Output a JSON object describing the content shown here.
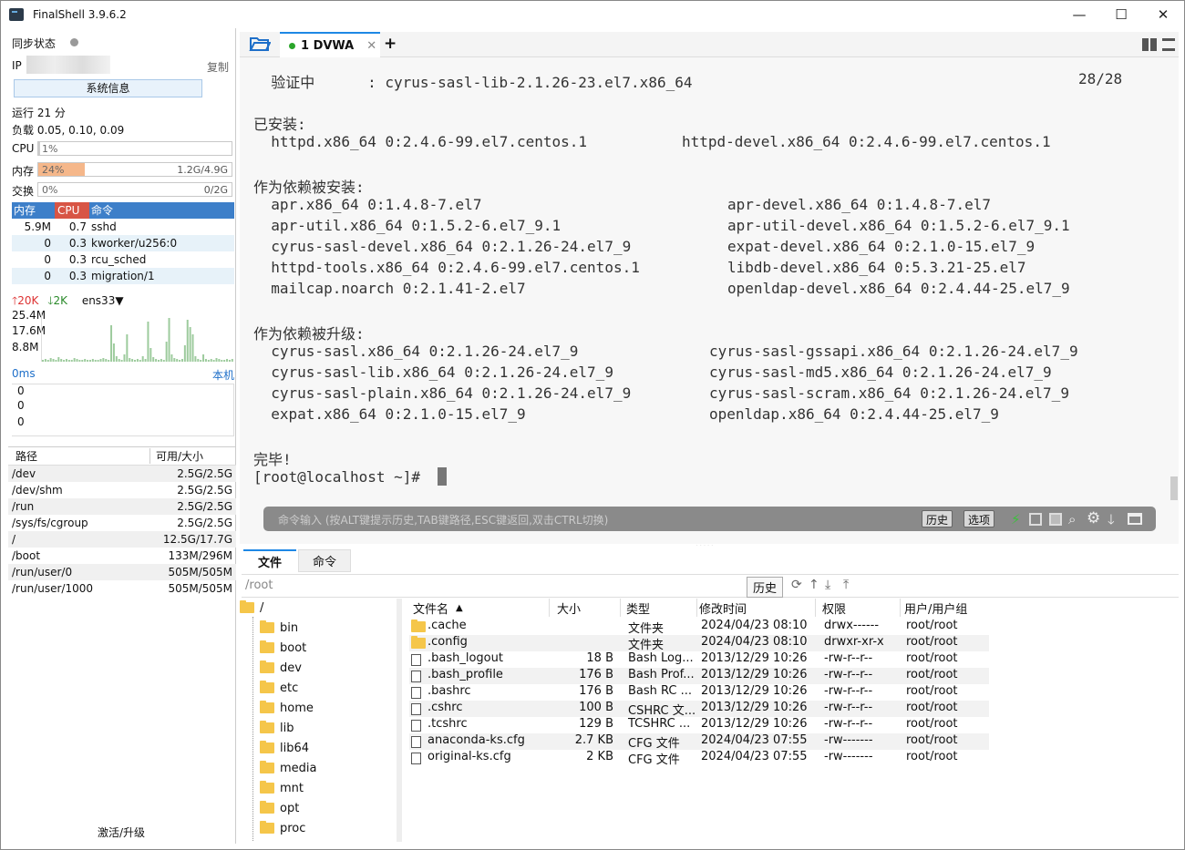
{
  "app": {
    "title": "FinalShell 3.9.6.2"
  },
  "window": {
    "minimize": "—",
    "maximize": "☐",
    "close": "✕"
  },
  "sidebar": {
    "sync_label": "同步状态",
    "ip_label": "IP",
    "copy_label": "复制",
    "sysinfo_button": "系统信息",
    "uptime": "运行 21 分",
    "load": "负载 0.05, 0.10, 0.09",
    "cpu": {
      "label": "CPU",
      "value": "1%",
      "fraction": 0.01
    },
    "mem": {
      "label": "内存",
      "value": "24%",
      "detail": "1.2G/4.9G",
      "fraction": 0.24
    },
    "swap": {
      "label": "交换",
      "value": "0%",
      "detail": "0/2G",
      "fraction": 0.0
    },
    "proc_headers": {
      "mem": "内存",
      "cpu": "CPU",
      "cmd": "命令"
    },
    "processes": [
      {
        "mem": "5.9M",
        "cpu": "0.7",
        "cmd": "sshd"
      },
      {
        "mem": "0",
        "cpu": "0.3",
        "cmd": "kworker/u256:0"
      },
      {
        "mem": "0",
        "cpu": "0.3",
        "cmd": "rcu_sched"
      },
      {
        "mem": "0",
        "cpu": "0.3",
        "cmd": "migration/1"
      }
    ],
    "net": {
      "up": "20K",
      "down": "2K",
      "iface": "ens33",
      "scale": [
        "25.4M",
        "17.6M",
        "8.8M"
      ]
    },
    "latency": {
      "label": "0ms",
      "local": "本机",
      "values": [
        "0",
        "0",
        "0"
      ]
    },
    "fs_headers": {
      "path": "路径",
      "size": "可用/大小"
    },
    "filesystems": [
      {
        "path": "/dev",
        "size": "2.5G/2.5G"
      },
      {
        "path": "/dev/shm",
        "size": "2.5G/2.5G"
      },
      {
        "path": "/run",
        "size": "2.5G/2.5G"
      },
      {
        "path": "/sys/fs/cgroup",
        "size": "2.5G/2.5G"
      },
      {
        "path": "/",
        "size": "12.5G/17.7G"
      },
      {
        "path": "/boot",
        "size": "133M/296M"
      },
      {
        "path": "/run/user/0",
        "size": "505M/505M"
      },
      {
        "path": "/run/user/1000",
        "size": "505M/505M"
      }
    ],
    "activate": "激活/升级"
  },
  "tabs": {
    "session": "1 DVWA",
    "add": "+"
  },
  "terminal": {
    "lines": [
      {
        "a": "  验证中      : cyrus-sasl-lib-2.1.26-23.el7.x86_64",
        "b": "28/28"
      },
      {
        "a": "已安装:"
      },
      {
        "a": "  httpd.x86_64 0:2.4.6-99.el7.centos.1",
        "b": "httpd-devel.x86_64 0:2.4.6-99.el7.centos.1"
      },
      {
        "a": "作为依赖被安装:"
      },
      {
        "a": "  apr.x86_64 0:1.4.8-7.el7",
        "b": "apr-devel.x86_64 0:1.4.8-7.el7"
      },
      {
        "a": "  apr-util.x86_64 0:1.5.2-6.el7_9.1",
        "b": "apr-util-devel.x86_64 0:1.5.2-6.el7_9.1"
      },
      {
        "a": "  cyrus-sasl-devel.x86_64 0:2.1.26-24.el7_9",
        "b": "expat-devel.x86_64 0:2.1.0-15.el7_9"
      },
      {
        "a": "  httpd-tools.x86_64 0:2.4.6-99.el7.centos.1",
        "b": "libdb-devel.x86_64 0:5.3.21-25.el7"
      },
      {
        "a": "  mailcap.noarch 0:2.1.41-2.el7",
        "b": "openldap-devel.x86_64 0:2.4.44-25.el7_9"
      },
      {
        "a": "作为依赖被升级:"
      },
      {
        "a": "  cyrus-sasl.x86_64 0:2.1.26-24.el7_9",
        "b": "cyrus-sasl-gssapi.x86_64 0:2.1.26-24.el7_9"
      },
      {
        "a": "  cyrus-sasl-lib.x86_64 0:2.1.26-24.el7_9",
        "b": "cyrus-sasl-md5.x86_64 0:2.1.26-24.el7_9"
      },
      {
        "a": "  cyrus-sasl-plain.x86_64 0:2.1.26-24.el7_9",
        "b": "cyrus-sasl-scram.x86_64 0:2.1.26-24.el7_9"
      },
      {
        "a": "  expat.x86_64 0:2.1.0-15.el7_9",
        "b": "openldap.x86_64 0:2.4.44-25.el7_9"
      },
      {
        "a": "完毕!"
      },
      {
        "a": "[root@localhost ~]#"
      }
    ],
    "cmd_placeholder": "命令输入 (按ALT键提示历史,TAB键路径,ESC键返回,双击CTRL切换)",
    "history_button": "历史",
    "options_button": "选项"
  },
  "bottom": {
    "tab_files": "文件",
    "tab_cmd": "命令",
    "path": "/root",
    "history_button": "历史",
    "tree_root": "/",
    "tree": [
      "bin",
      "boot",
      "dev",
      "etc",
      "home",
      "lib",
      "lib64",
      "media",
      "mnt",
      "opt",
      "proc"
    ],
    "headers": {
      "name": "文件名",
      "size": "大小",
      "type": "类型",
      "mtime": "修改时间",
      "perm": "权限",
      "owner": "用户/用户组"
    },
    "files": [
      {
        "name": ".cache",
        "size": "",
        "type": "文件夹",
        "mtime": "2024/04/23 08:10",
        "perm": "drwx------",
        "owner": "root/root",
        "kind": "folder"
      },
      {
        "name": ".config",
        "size": "",
        "type": "文件夹",
        "mtime": "2024/04/23 08:10",
        "perm": "drwxr-xr-x",
        "owner": "root/root",
        "kind": "folder"
      },
      {
        "name": ".bash_logout",
        "size": "18 B",
        "type": "Bash Log...",
        "mtime": "2013/12/29 10:26",
        "perm": "-rw-r--r--",
        "owner": "root/root",
        "kind": "file"
      },
      {
        "name": ".bash_profile",
        "size": "176 B",
        "type": "Bash Prof...",
        "mtime": "2013/12/29 10:26",
        "perm": "-rw-r--r--",
        "owner": "root/root",
        "kind": "file"
      },
      {
        "name": ".bashrc",
        "size": "176 B",
        "type": "Bash RC ...",
        "mtime": "2013/12/29 10:26",
        "perm": "-rw-r--r--",
        "owner": "root/root",
        "kind": "file"
      },
      {
        "name": ".cshrc",
        "size": "100 B",
        "type": "CSHRC 文...",
        "mtime": "2013/12/29 10:26",
        "perm": "-rw-r--r--",
        "owner": "root/root",
        "kind": "file"
      },
      {
        "name": ".tcshrc",
        "size": "129 B",
        "type": "TCSHRC ...",
        "mtime": "2013/12/29 10:26",
        "perm": "-rw-r--r--",
        "owner": "root/root",
        "kind": "file"
      },
      {
        "name": "anaconda-ks.cfg",
        "size": "2.7 KB",
        "type": "CFG 文件",
        "mtime": "2024/04/23 07:55",
        "perm": "-rw-------",
        "owner": "root/root",
        "kind": "file"
      },
      {
        "name": "original-ks.cfg",
        "size": "2 KB",
        "type": "CFG 文件",
        "mtime": "2024/04/23 07:55",
        "perm": "-rw-------",
        "owner": "root/root",
        "kind": "file"
      }
    ]
  }
}
